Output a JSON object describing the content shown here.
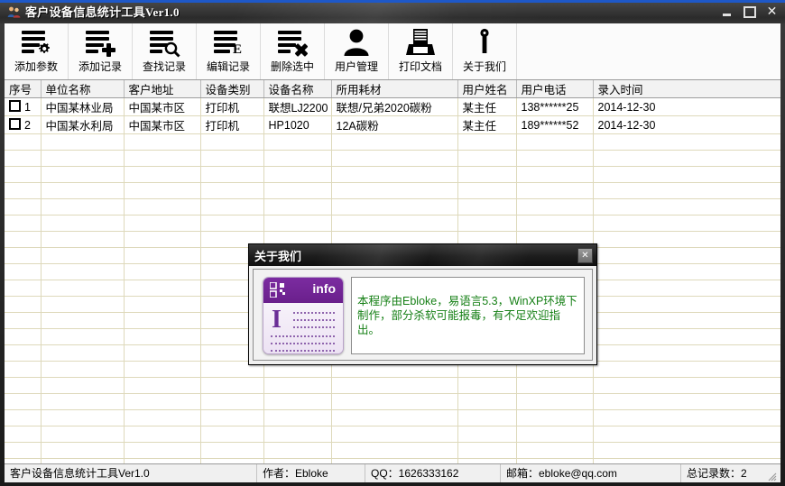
{
  "window": {
    "title": "客户设备信息统计工具Ver1.0",
    "app_icon": "people-icon",
    "minimize_label": "最小化",
    "maximize_label": "最大化",
    "close_label": "✕"
  },
  "toolbar": {
    "buttons": [
      {
        "label": "添加参数",
        "icon": "list-gear-icon"
      },
      {
        "label": "添加记录",
        "icon": "list-plus-icon"
      },
      {
        "label": "查找记录",
        "icon": "list-search-icon"
      },
      {
        "label": "编辑记录",
        "icon": "list-edit-icon"
      },
      {
        "label": "删除选中",
        "icon": "list-delete-icon"
      },
      {
        "label": "用户管理",
        "icon": "user-icon"
      },
      {
        "label": "打印文档",
        "icon": "printer-icon"
      },
      {
        "label": "关于我们",
        "icon": "about-key-icon"
      }
    ]
  },
  "grid": {
    "columns": [
      "序号",
      "单位名称",
      "客户地址",
      "设备类别",
      "设备名称",
      "所用耗材",
      "用户姓名",
      "用户电话",
      "录入时间"
    ],
    "rows": [
      {
        "checked": false,
        "index": "1",
        "unit": "中国某林业局",
        "address": "中国某市区",
        "category": "打印机",
        "device": "联想LJ2200",
        "consumable": "联想/兄弟2020碳粉",
        "user": "某主任",
        "phone": "138******25",
        "date": "2014-12-30"
      },
      {
        "checked": false,
        "index": "2",
        "unit": "中国某水利局",
        "address": "中国某市区",
        "category": "打印机",
        "device": "HP1020",
        "consumable": "12A碳粉",
        "user": "某主任",
        "phone": "189******52",
        "date": "2014-12-30"
      }
    ],
    "empty_row_count": 21
  },
  "dialog": {
    "title": "关于我们",
    "close_label": "✕",
    "card": {
      "header_text": "info",
      "icon": "qr-blocks-icon",
      "letter": "I"
    },
    "message": "本程序由Ebloke，易语言5.3，WinXP环境下制作，部分杀软可能报毒，有不足欢迎指出。",
    "message_color": "#168016"
  },
  "statusbar": {
    "cells": [
      "客户设备信息统计工具Ver1.0",
      "作者：Ebloke",
      "QQ：1626333162",
      "邮箱：ebloke@qq.com",
      "总记录数：2"
    ]
  }
}
